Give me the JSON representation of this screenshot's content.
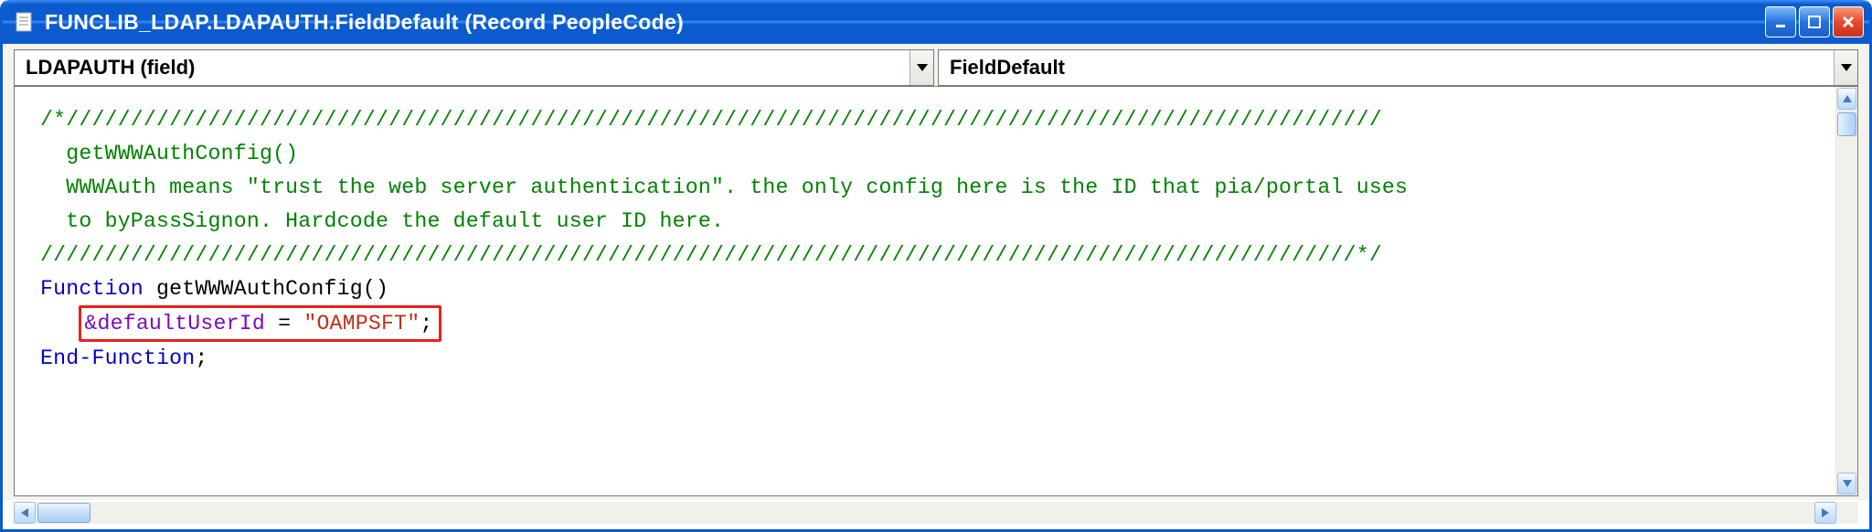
{
  "window": {
    "title": "FUNCLIB_LDAP.LDAPAUTH.FieldDefault (Record PeopleCode)"
  },
  "dropdowns": {
    "field": "LDAPAUTH   (field)",
    "event": "FieldDefault"
  },
  "code": {
    "comment_slashes1": "/*//////////////////////////////////////////////////////////////////////////////////////////////////////",
    "comment_l2": "  getWWWAuthConfig()",
    "comment_l3": "  WWWAuth means \"trust the web server authentication\". the only config here is the ID that pia/portal uses",
    "comment_l4": "  to byPassSignon. Hardcode the default user ID here.",
    "comment_slashes2": "//////////////////////////////////////////////////////////////////////////////////////////////////////*/",
    "kw_function": "Function",
    "func_name": " getWWWAuthConfig()",
    "assign_var": "&defaultUserId",
    "assign_eq": " = ",
    "assign_str": "\"OAMPSFT\"",
    "assign_semi": ";",
    "kw_endfunction": "End-Function",
    "end_semi": ";"
  }
}
